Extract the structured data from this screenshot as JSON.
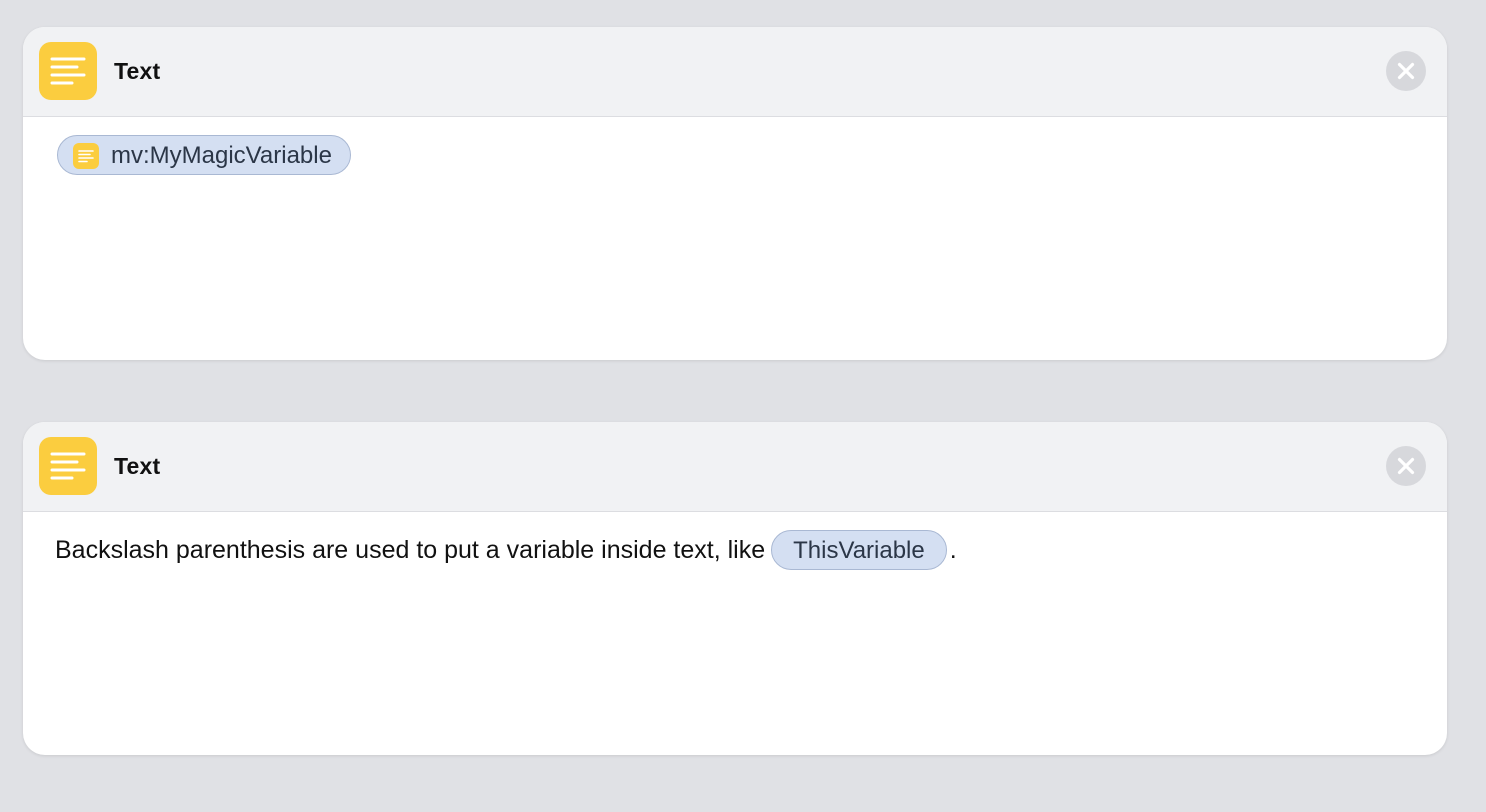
{
  "cards": [
    {
      "title": "Text",
      "icon": "text-lines-icon",
      "close_icon": "close-icon",
      "body": {
        "token": {
          "label": "mv:MyMagicVariable",
          "icon": "text-lines-icon"
        }
      }
    },
    {
      "title": "Text",
      "icon": "text-lines-icon",
      "close_icon": "close-icon",
      "body": {
        "text_before": "Backslash parenthesis are used to put a variable inside text, like",
        "token": {
          "label": "ThisVariable"
        },
        "text_after": "."
      }
    }
  ],
  "colors": {
    "background": "#e0e1e5",
    "card": "#ffffff",
    "header": "#f1f2f4",
    "icon_yellow": "#fbcd3f",
    "token_fill": "#d4dff2",
    "token_border": "#a9b8d3",
    "close_button": "#d7d8dc"
  }
}
